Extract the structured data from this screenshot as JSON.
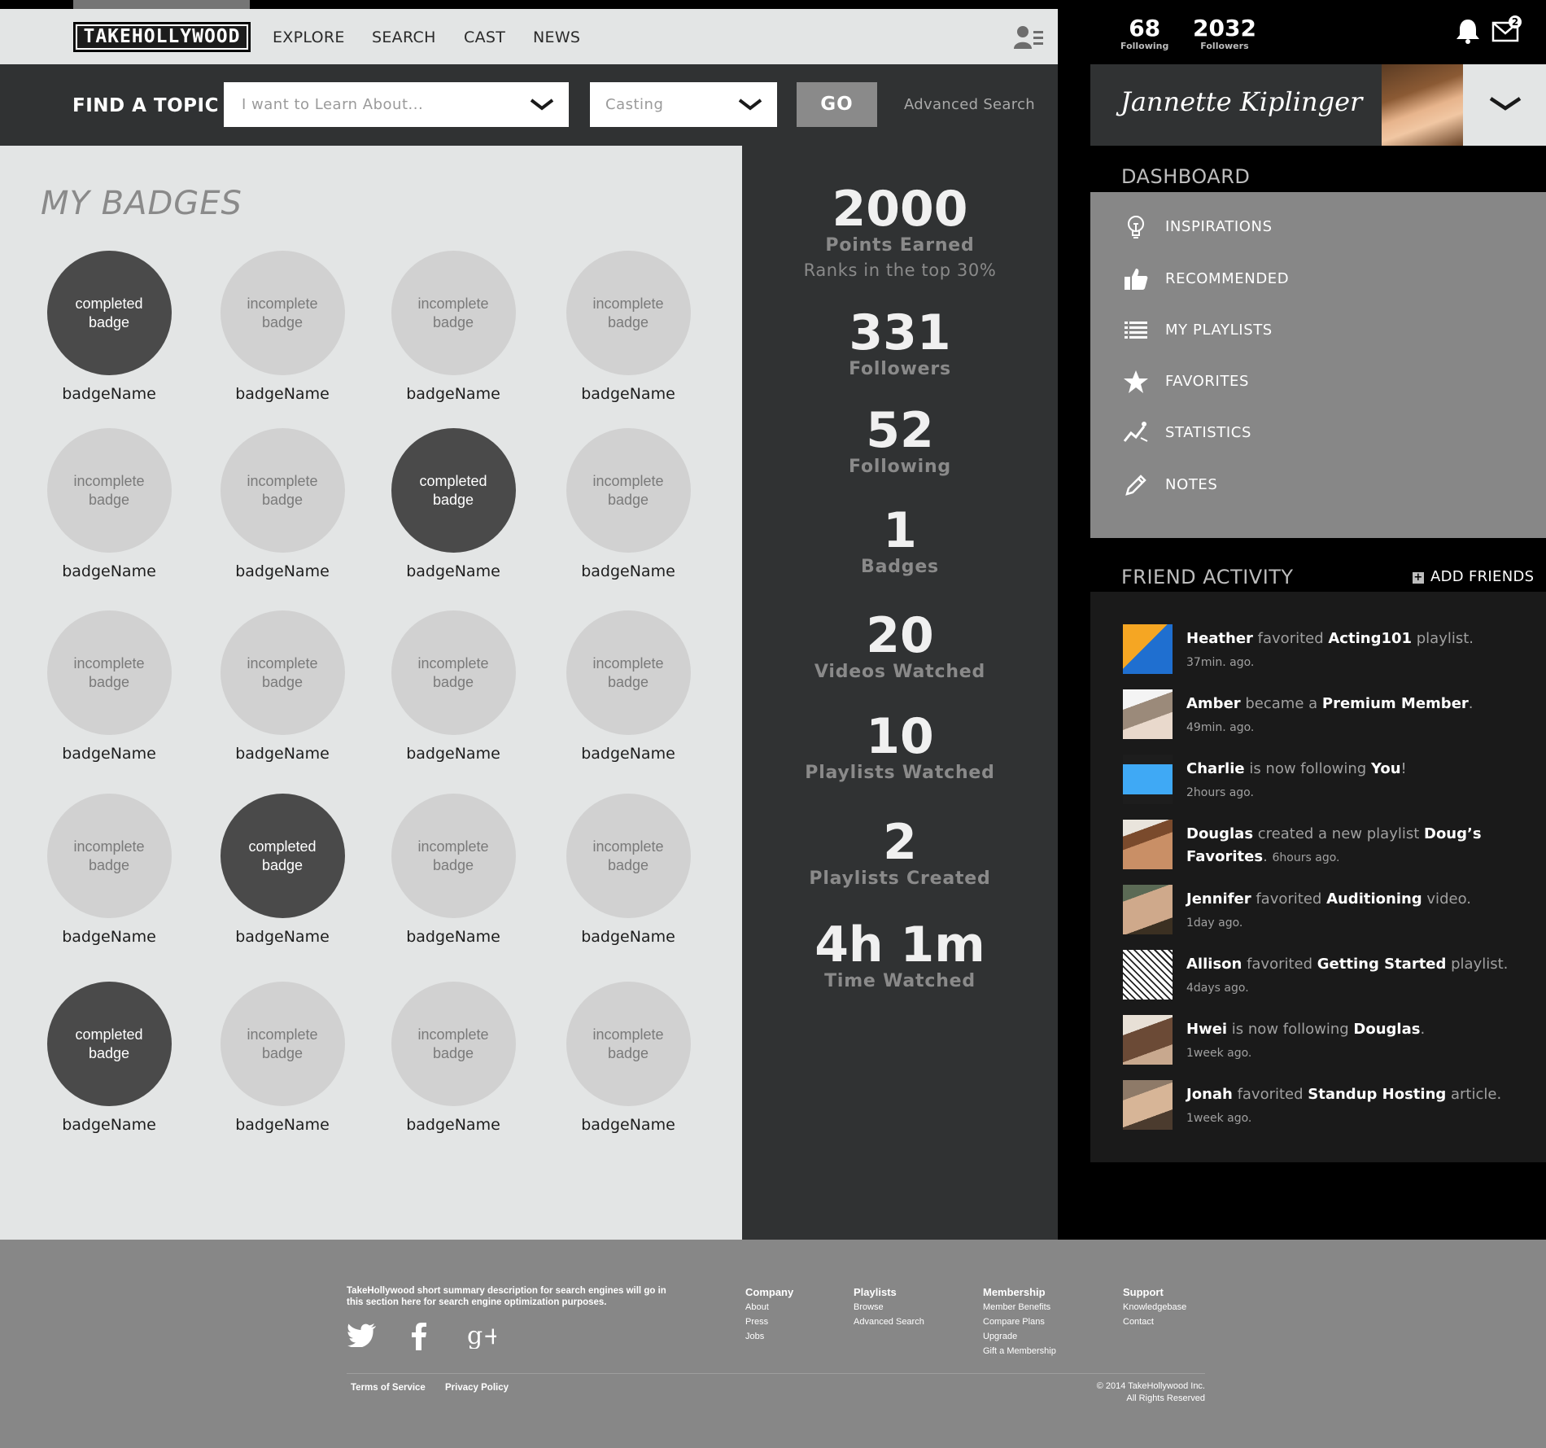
{
  "brand": {
    "logo_text": "TAKEHOLLYWOOD"
  },
  "nav": {
    "items": [
      "EXPLORE",
      "SEARCH",
      "CAST",
      "NEWS"
    ]
  },
  "search": {
    "find_label": "FIND A TOPIC",
    "topic_placeholder": "I want to Learn About...",
    "category_value": "Casting",
    "go_label": "GO",
    "advanced_label": "Advanced Search"
  },
  "badges": {
    "title": "MY BADGES",
    "items": [
      {
        "status": "completed badge",
        "name": "badgeName",
        "completed": true
      },
      {
        "status": "incomplete badge",
        "name": "badgeName",
        "completed": false
      },
      {
        "status": "incomplete badge",
        "name": "badgeName",
        "completed": false
      },
      {
        "status": "incomplete badge",
        "name": "badgeName",
        "completed": false
      },
      {
        "status": "incomplete badge",
        "name": "badgeName",
        "completed": false
      },
      {
        "status": "incomplete badge",
        "name": "badgeName",
        "completed": false
      },
      {
        "status": "completed badge",
        "name": "badgeName",
        "completed": true
      },
      {
        "status": "incomplete badge",
        "name": "badgeName",
        "completed": false
      },
      {
        "status": "incomplete badge",
        "name": "badgeName",
        "completed": false
      },
      {
        "status": "incomplete badge",
        "name": "badgeName",
        "completed": false
      },
      {
        "status": "incomplete badge",
        "name": "badgeName",
        "completed": false
      },
      {
        "status": "incomplete badge",
        "name": "badgeName",
        "completed": false
      },
      {
        "status": "incomplete badge",
        "name": "badgeName",
        "completed": false
      },
      {
        "status": "completed badge",
        "name": "badgeName",
        "completed": true
      },
      {
        "status": "incomplete badge",
        "name": "badgeName",
        "completed": false
      },
      {
        "status": "incomplete badge",
        "name": "badgeName",
        "completed": false
      },
      {
        "status": "completed badge",
        "name": "badgeName",
        "completed": true
      },
      {
        "status": "incomplete badge",
        "name": "badgeName",
        "completed": false
      },
      {
        "status": "incomplete badge",
        "name": "badgeName",
        "completed": false
      },
      {
        "status": "incomplete badge",
        "name": "badgeName",
        "completed": false
      }
    ]
  },
  "stats": [
    {
      "value": "2000",
      "label": "Points Earned",
      "sub": "Ranks in the top 30%"
    },
    {
      "value": "331",
      "label": "Followers"
    },
    {
      "value": "52",
      "label": "Following"
    },
    {
      "value": "1",
      "label": "Badges"
    },
    {
      "value": "20",
      "label": "Videos Watched"
    },
    {
      "value": "10",
      "label": "Playlists Watched"
    },
    {
      "value": "2",
      "label": "Playlists Created"
    },
    {
      "value": "4h 1m",
      "label": "Time Watched"
    }
  ],
  "header_counts": {
    "following": {
      "value": "68",
      "label": "Following"
    },
    "followers": {
      "value": "2032",
      "label": "Followers"
    },
    "mail_badge": "2"
  },
  "profile": {
    "name": "Jannette Kiplinger"
  },
  "dashboard": {
    "title": "DASHBOARD",
    "items": [
      {
        "label": "INSPIRATIONS",
        "icon": "lightbulb-icon"
      },
      {
        "label": "RECOMMENDED",
        "icon": "thumbs-up-icon"
      },
      {
        "label": "MY PLAYLISTS",
        "icon": "list-icon"
      },
      {
        "label": "FAVORITES",
        "icon": "star-icon"
      },
      {
        "label": "STATISTICS",
        "icon": "trend-icon"
      },
      {
        "label": "NOTES",
        "icon": "pencil-icon"
      }
    ]
  },
  "friend_activity": {
    "title": "FRIEND ACTIVITY",
    "add_label": "ADD FRIENDS",
    "items": [
      {
        "user": "Heather",
        "verb": " favorited ",
        "object": "Acting101",
        "suffix": " playlist.",
        "time": "37min. ago."
      },
      {
        "user": "Amber",
        "verb": " became a ",
        "object": "Premium Member",
        "suffix": ".",
        "time": "49min. ago."
      },
      {
        "user": "Charlie",
        "verb": " is now following ",
        "object": "You",
        "suffix": "!",
        "time": "2hours ago."
      },
      {
        "user": "Douglas",
        "verb": " created a new playlist ",
        "object": "Doug’s Favorites",
        "suffix": ". ",
        "time": "6hours ago."
      },
      {
        "user": "Jennifer",
        "verb": " favorited ",
        "object": "Auditioning",
        "suffix": " video.",
        "time": "1day ago."
      },
      {
        "user": "Allison",
        "verb": " favorited ",
        "object": "Getting Started",
        "suffix": " playlist.",
        "time": "4days ago."
      },
      {
        "user": "Hwei",
        "verb": " is now following ",
        "object": "Douglas",
        "suffix": ".",
        "time": "1week ago."
      },
      {
        "user": "Jonah",
        "verb": " favorited ",
        "object": "Standup Hosting",
        "suffix": " article.",
        "time": "1week ago."
      }
    ]
  },
  "footer": {
    "summary": "TakeHollywood short summary description for  search engines will go in this section here for search engine optimization purposes.",
    "columns": [
      {
        "heading": "Company",
        "links": [
          "About",
          "Press",
          "Jobs"
        ]
      },
      {
        "heading": "Playlists",
        "links": [
          "Browse",
          "Advanced Search"
        ]
      },
      {
        "heading": "Membership",
        "links": [
          "Member Benefits",
          "Compare Plans",
          "Upgrade",
          "Gift a Membership"
        ]
      },
      {
        "heading": "Support",
        "links": [
          "Knowledgebase",
          "Contact"
        ]
      }
    ],
    "terms": "Terms of Service",
    "privacy": "Privacy Policy",
    "copyright_1": "© 2014 TakeHollywood Inc.",
    "copyright_2": "All Rights Reserved"
  }
}
